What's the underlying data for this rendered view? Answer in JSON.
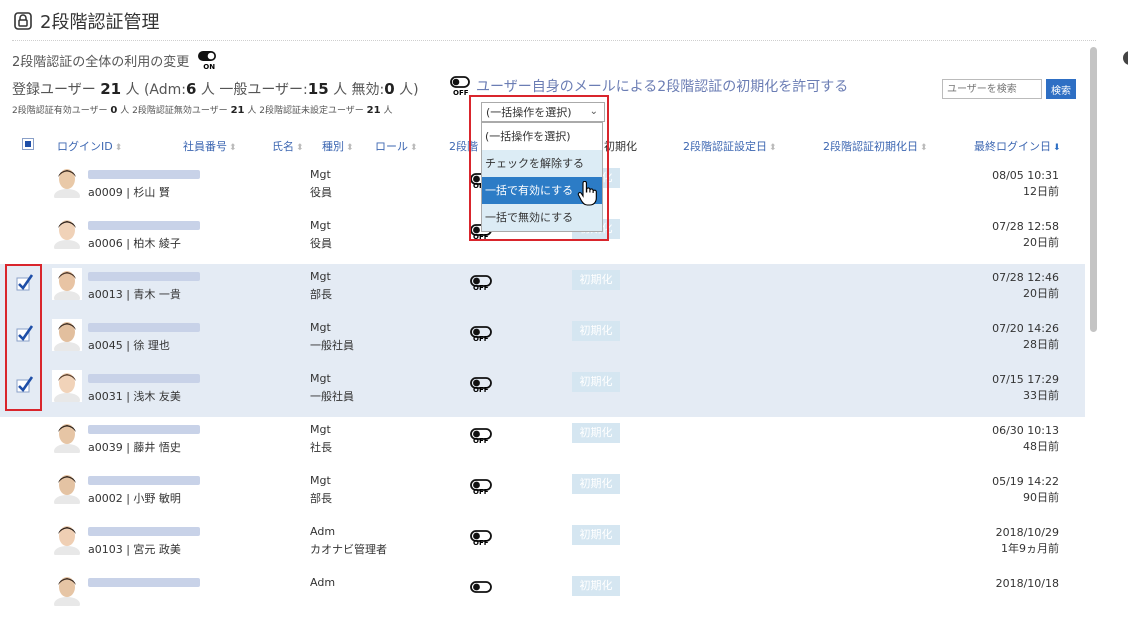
{
  "page": {
    "title": "2段階認証管理",
    "global_label": "2段階認証の全体の利用の変更",
    "global_state": "ON"
  },
  "stats": {
    "registered_label": "登録ユーザー",
    "registered_count": "21",
    "registered_paren_open": "人 (Adm:",
    "adm_count": "6",
    "general_label": "人 一般ユーザー:",
    "general_count": "15",
    "invalid_label": "人 無効:",
    "invalid_count": "0",
    "close_paren": "人)",
    "sub_enabled_label": "2段階認証有効ユーザー",
    "sub_enabled_count": "0",
    "sub_disabled_label": "人 2段階認証無効ユーザー",
    "sub_disabled_count": "21",
    "sub_unset_label": "人 2段階認証未設定ユーザー",
    "sub_unset_count": "21",
    "sub_tail": "人"
  },
  "allow_toggle": {
    "state": "OFF",
    "label": "ユーザー自身のメールによる2段階認証の初期化を許可する"
  },
  "search": {
    "placeholder": "ユーザーを検索",
    "button_label": "検索"
  },
  "bulk": {
    "selected": "(一括操作を選択)",
    "options": [
      "(一括操作を選択)",
      "チェックを解除する",
      "一括で有効にする",
      "一括で無効にする"
    ],
    "highlighted_index": 2
  },
  "columns": {
    "login_id": "ログインID",
    "emp_no": "社員番号",
    "name": "氏名",
    "kind": "種別",
    "role": "ロール",
    "twofa": "2段階",
    "reset": "初期化",
    "set_date": "2段階認証設定日",
    "reset_date": "2段階認証初期化日",
    "last_login": "最終ログイン日"
  },
  "rows": [
    {
      "id": "a0009 | 杉山 賢",
      "kind": "Mgt",
      "role": "役員",
      "twofa": "OFF",
      "reset": "初期化",
      "last_date": "08/05 10:31",
      "last_rel": "12日前",
      "checked": false
    },
    {
      "id": "a0006 | 柏木 綾子",
      "kind": "Mgt",
      "role": "役員",
      "twofa": "OFF",
      "reset": "初期化",
      "last_date": "07/28 12:58",
      "last_rel": "20日前",
      "checked": false
    },
    {
      "id": "a0013 | 青木 一貴",
      "kind": "Mgt",
      "role": "部長",
      "twofa": "OFF",
      "reset": "初期化",
      "last_date": "07/28 12:46",
      "last_rel": "20日前",
      "checked": true
    },
    {
      "id": "a0045 | 徐 理也",
      "kind": "Mgt",
      "role": "一般社員",
      "twofa": "OFF",
      "reset": "初期化",
      "last_date": "07/20 14:26",
      "last_rel": "28日前",
      "checked": true
    },
    {
      "id": "a0031 | 浅木 友美",
      "kind": "Mgt",
      "role": "一般社員",
      "twofa": "OFF",
      "reset": "初期化",
      "last_date": "07/15 17:29",
      "last_rel": "33日前",
      "checked": true
    },
    {
      "id": "a0039 | 藤井 悟史",
      "kind": "Mgt",
      "role": "社長",
      "twofa": "OFF",
      "reset": "初期化",
      "last_date": "06/30 10:13",
      "last_rel": "48日前",
      "checked": false
    },
    {
      "id": "a0002 | 小野 敏明",
      "kind": "Mgt",
      "role": "部長",
      "twofa": "OFF",
      "reset": "初期化",
      "last_date": "05/19 14:22",
      "last_rel": "90日前",
      "checked": false
    },
    {
      "id": "a0103 | 宮元 政美",
      "kind": "Adm",
      "role": "カオナビ管理者",
      "twofa": "OFF",
      "reset": "初期化",
      "last_date": "2018/10/29",
      "last_rel": "1年9ヵ月前",
      "checked": false
    },
    {
      "id": "",
      "kind": "Adm",
      "role": "",
      "twofa": "",
      "reset": "初期化",
      "last_date": "2018/10/18",
      "last_rel": "",
      "checked": false
    }
  ],
  "colors": {
    "accent": "#2e6fc4",
    "link": "#3d67b2",
    "selected_row": "#e4ebf4",
    "highlight_border": "#d9252c"
  }
}
